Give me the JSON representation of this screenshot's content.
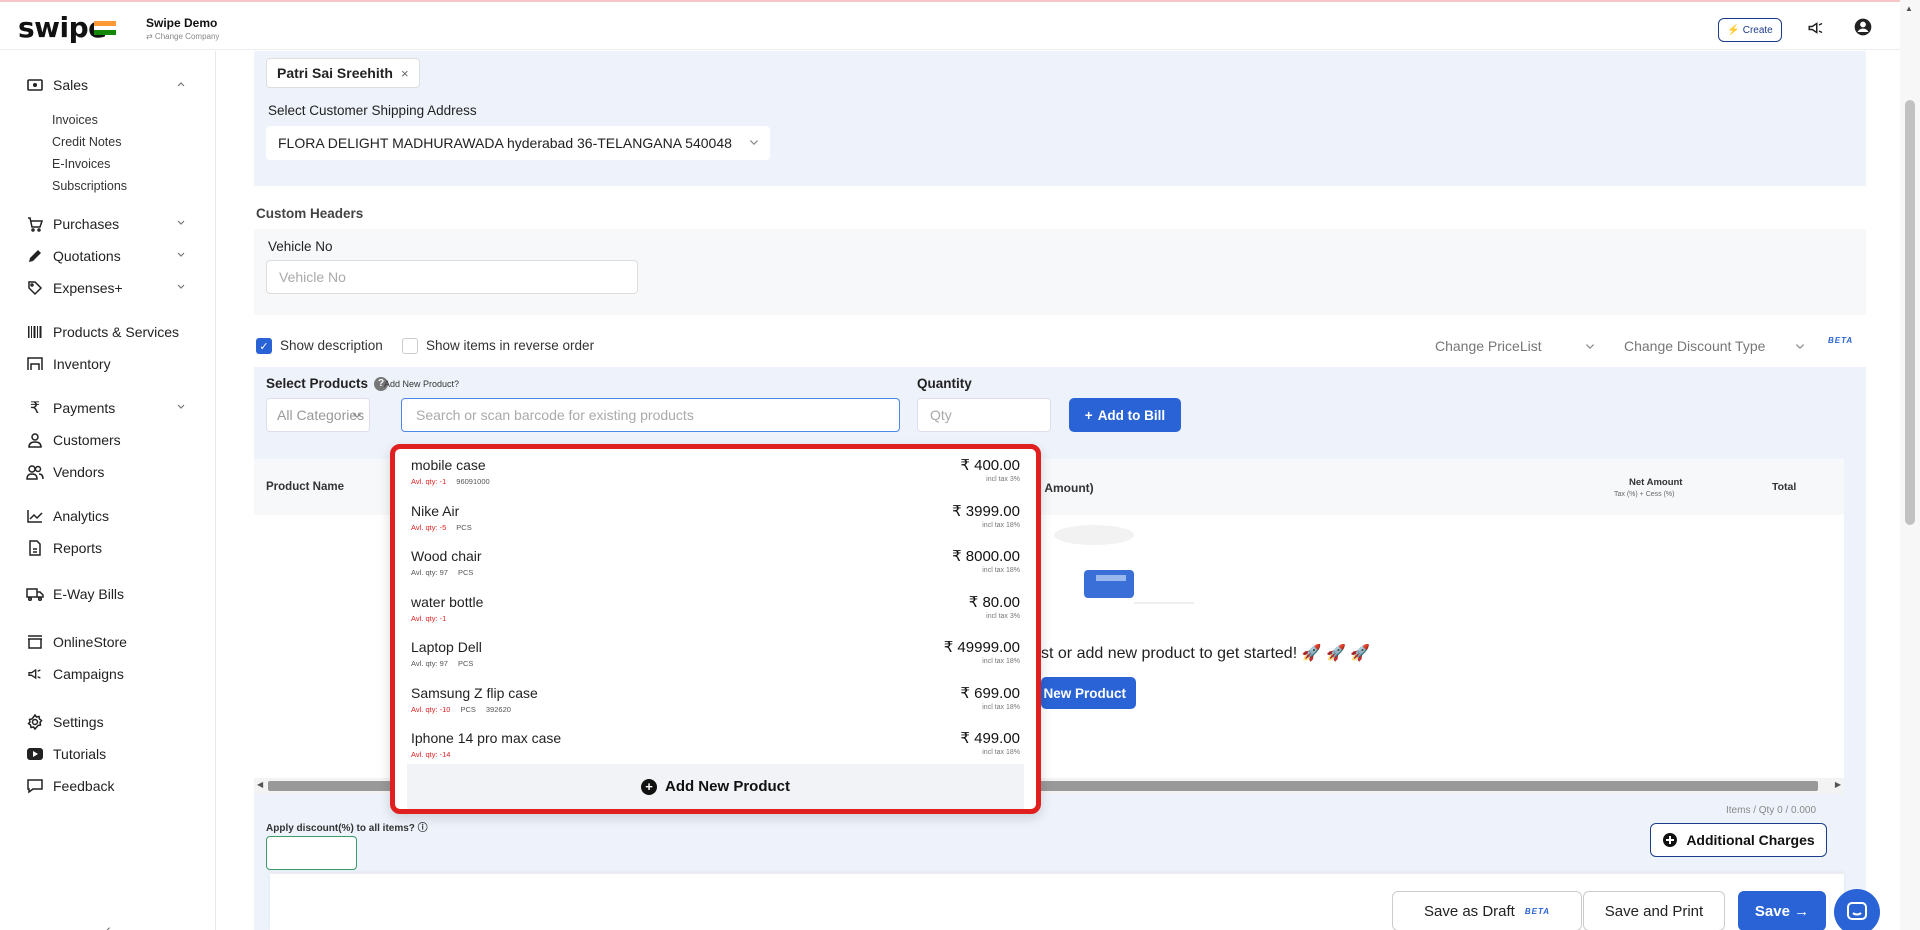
{
  "topbar": {
    "logo": "swipe",
    "company_name": "Swipe Demo",
    "change_company": "⇄ Change Company",
    "create_label": "Create"
  },
  "sidebar": {
    "sales": "Sales",
    "sales_sub": [
      "Invoices",
      "Credit Notes",
      "E-Invoices",
      "Subscriptions"
    ],
    "purchases": "Purchases",
    "quotations": "Quotations",
    "expenses": "Expenses+",
    "products_services": "Products & Services",
    "inventory": "Inventory",
    "payments": "Payments",
    "customers": "Customers",
    "vendors": "Vendors",
    "analytics": "Analytics",
    "reports": "Reports",
    "eway_bills": "E-Way Bills",
    "online_store": "OnlineStore",
    "campaigns": "Campaigns",
    "settings": "Settings",
    "tutorials": "Tutorials",
    "feedback": "Feedback"
  },
  "customer": {
    "name": "Patri Sai Sreehith",
    "ship_label": "Select Customer Shipping Address",
    "ship_value": "FLORA DELIGHT MADHURAWADA hyderabad 36-TELANGANA 540048"
  },
  "custom_headers": {
    "title": "Custom Headers",
    "vehicle_label": "Vehicle No",
    "vehicle_placeholder": "Vehicle No"
  },
  "options": {
    "show_description": "Show description",
    "show_description_checked": true,
    "reverse_order": "Show items in reverse order",
    "price_list": "Change PriceList",
    "discount_type": "Change Discount Type",
    "beta": "BETA"
  },
  "products": {
    "select_label": "Select Products",
    "add_new_hint": "Add New Product?",
    "quantity_label": "Quantity",
    "category_value": "All Categories",
    "search_placeholder": "Search or scan barcode for existing products",
    "qty_placeholder": "Qty",
    "add_to_bill": "Add to Bill"
  },
  "table": {
    "col_product_name": "Product Name",
    "col_discount": "Discount (Total Amount)",
    "col_net_amount": "Net Amount",
    "col_net_amount_sub": "Tax (%) + Cess (%)",
    "col_total": "Total",
    "empty_text": "st or add new product to get started! 🚀 🚀 🚀",
    "add_new_product_btn": "New Product",
    "items_summary": "Items / Qty 0 / 0.000",
    "apply_discount_label": "Apply discount(%) to all items? ⓘ",
    "additional_charges": "Additional Charges"
  },
  "dropdown": {
    "items": [
      {
        "name": "mobile case",
        "price": "₹ 400.00",
        "qty": "Avl. qty: -1",
        "qty_negative": true,
        "unit": "",
        "code": "96091000",
        "tax": "incl tax 3%"
      },
      {
        "name": "Nike Air",
        "price": "₹ 3999.00",
        "qty": "Avl. qty: -5",
        "qty_negative": true,
        "unit": "PCS",
        "code": "",
        "tax": "incl tax 18%"
      },
      {
        "name": "Wood chair",
        "price": "₹ 8000.00",
        "qty": "Avl. qty: 97",
        "qty_negative": false,
        "unit": "PCS",
        "code": "",
        "tax": "incl tax 18%"
      },
      {
        "name": "water bottle",
        "price": "₹ 80.00",
        "qty": "Avl. qty: -1",
        "qty_negative": true,
        "unit": "",
        "code": "",
        "tax": "incl tax 3%"
      },
      {
        "name": "Laptop Dell",
        "price": "₹ 49999.00",
        "qty": "Avl. qty: 97",
        "qty_negative": false,
        "unit": "PCS",
        "code": "",
        "tax": "incl tax 18%"
      },
      {
        "name": "Samsung Z flip case",
        "price": "₹ 699.00",
        "qty": "Avl. qty: -10",
        "qty_negative": true,
        "unit": "PCS",
        "code": "392620",
        "tax": "incl tax 18%"
      },
      {
        "name": "Iphone 14 pro max case",
        "price": "₹ 499.00",
        "qty": "Avl. qty: -14",
        "qty_negative": true,
        "unit": "",
        "code": "",
        "tax": "incl tax 18%"
      }
    ],
    "add_new": "Add New Product"
  },
  "footer": {
    "save_draft": "Save as Draft",
    "save_draft_beta": "BETA",
    "save_print": "Save and Print",
    "save": "Save →"
  },
  "colors": {
    "accent": "#2a63d6",
    "highlight_border": "#e01f1f",
    "panel_bg": "#eef3fb"
  }
}
